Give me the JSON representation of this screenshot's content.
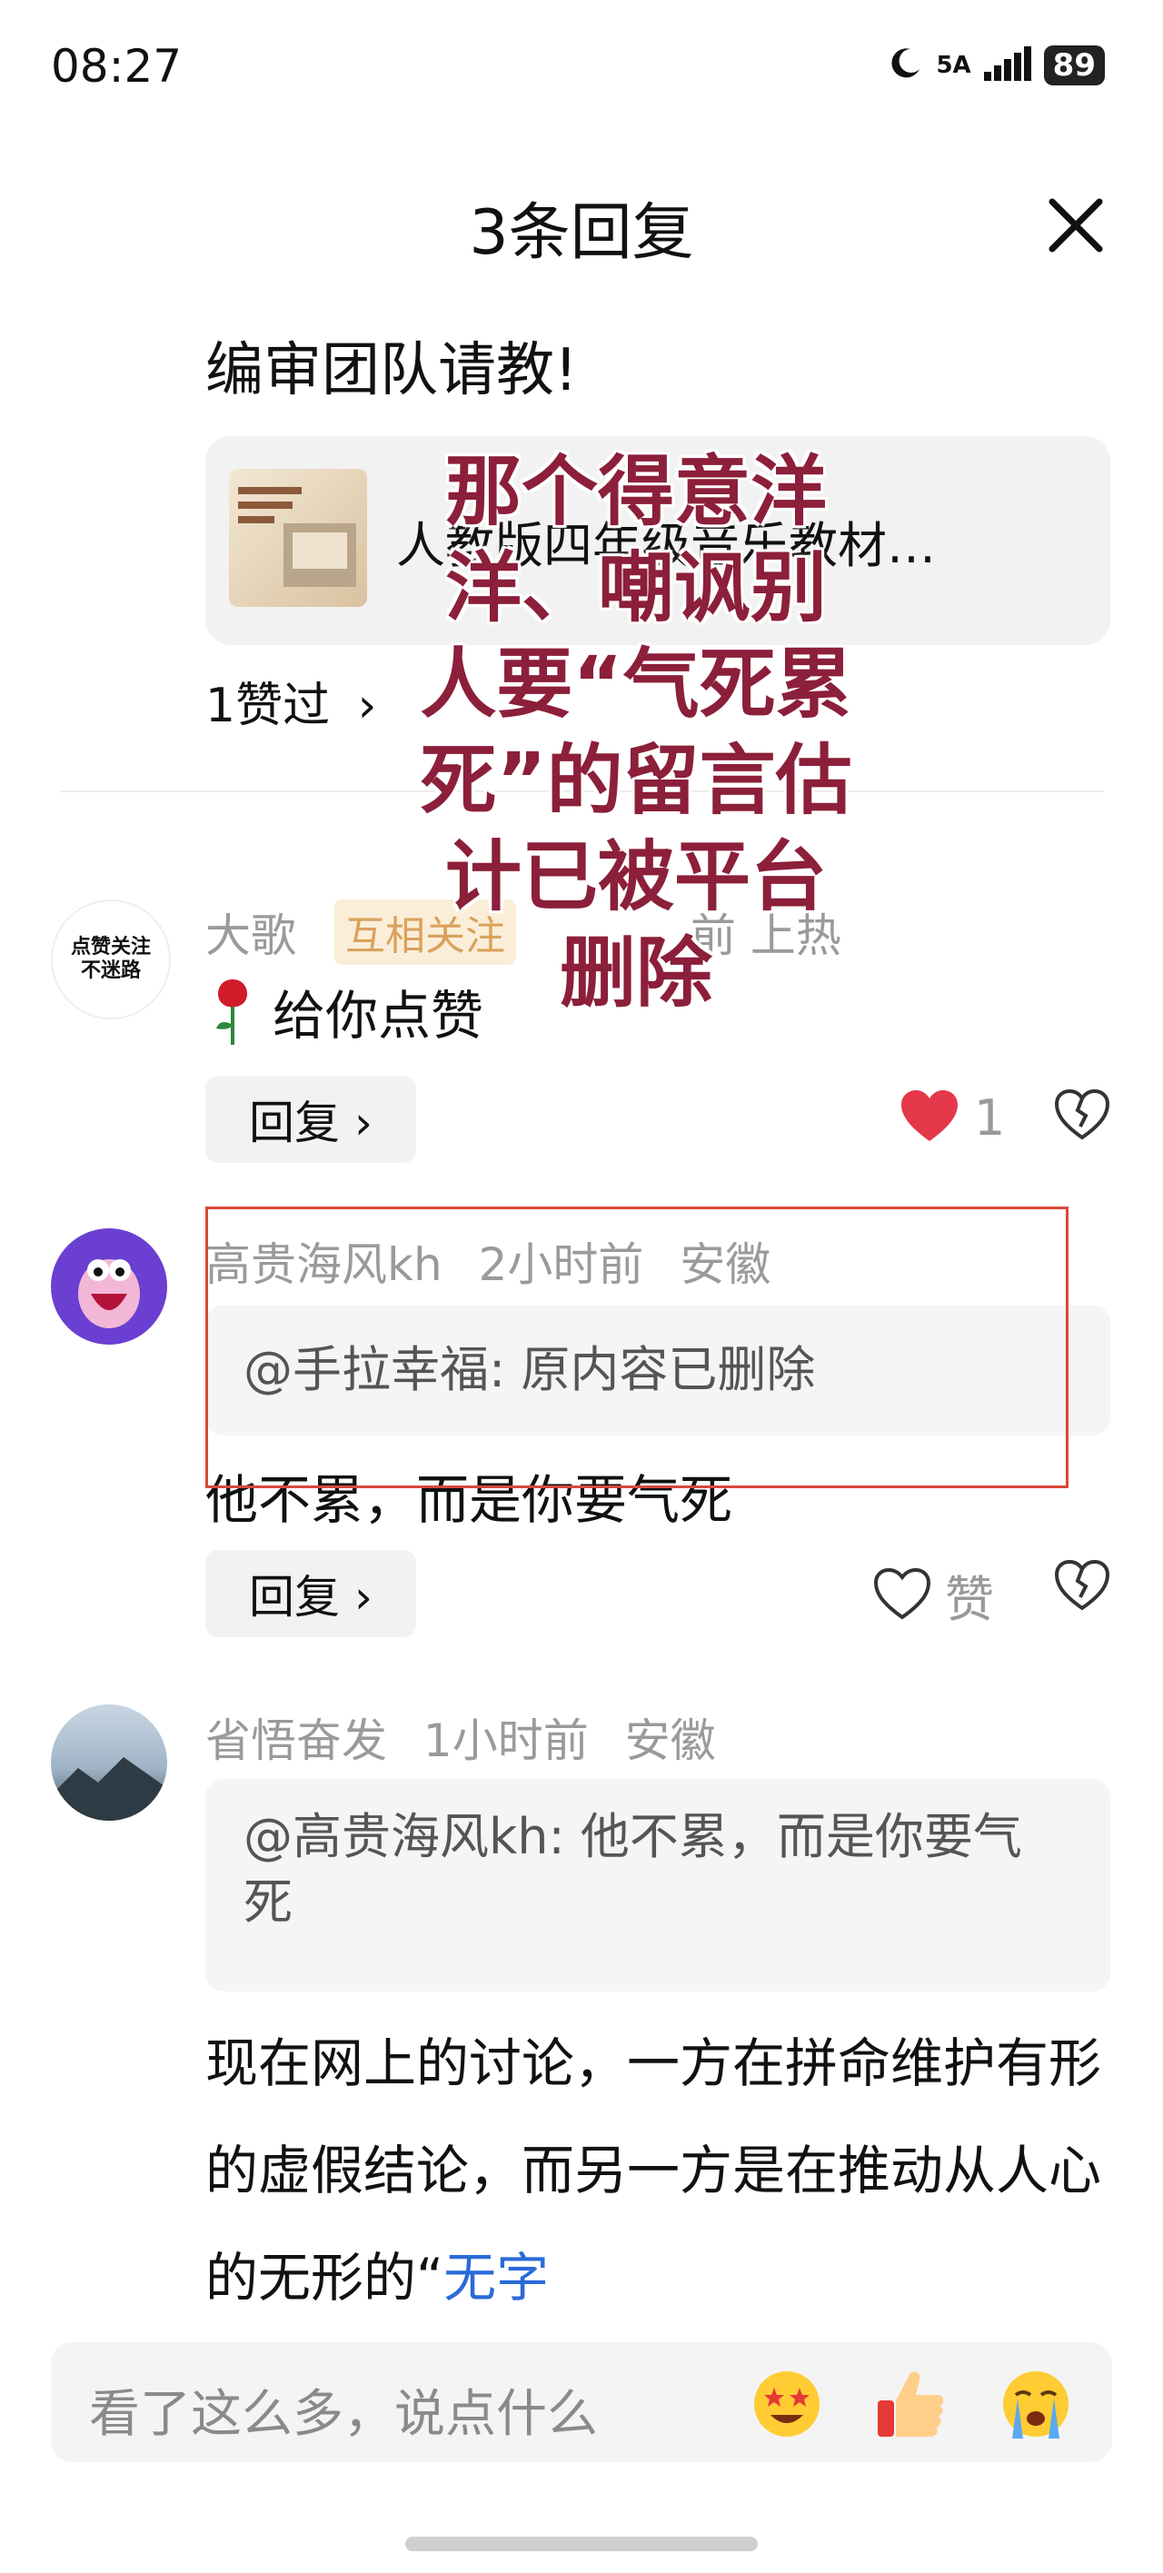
{
  "status_bar": {
    "time": "08:27",
    "network": "5A",
    "battery": "89"
  },
  "header": {
    "title": "3条回复"
  },
  "original_post": {
    "text_tail": "编审团队请教!",
    "link_card": {
      "title": "人教版四年级音乐教材…"
    },
    "likes_label": "1赞过",
    "likes_chevron": "›"
  },
  "overlay_annotation": {
    "lines": [
      "那个得意洋",
      "洋、嘲讽别",
      "人要“气死累",
      "死”的留言估",
      "计已被平台",
      "删除"
    ]
  },
  "comments": [
    {
      "avatar_text": "点赞关注\n不迷路",
      "username": "大歌",
      "badge": "互相关注",
      "meta": "前 上热",
      "text": "给你点赞",
      "reply_label": "回复 ›",
      "like_count": "1"
    },
    {
      "username": "高贵海风kh",
      "time": "2小时前",
      "location": "安徽",
      "quote": "@手拉幸福: 原内容已删除",
      "text": "他不累，而是你要气死",
      "reply_label": "回复 ›",
      "like_label": "赞"
    },
    {
      "username": "省悟奋发",
      "time": "1小时前",
      "location": "安徽",
      "quote": "@高贵海风kh: 他不累，而是你要气死",
      "text_plain": "现在网上的讨论，一方在拼命维护有形的虚假结论，而另一方是在推动从人心的无形的“",
      "text_link": "无字"
    }
  ],
  "input_bar": {
    "placeholder": "看了这么多，说点什么"
  },
  "colors": {
    "overlay": "#8c1f3a",
    "like_red": "#e5384a",
    "link_blue": "#2a6ad9",
    "highlight_box": "#d9483b"
  }
}
